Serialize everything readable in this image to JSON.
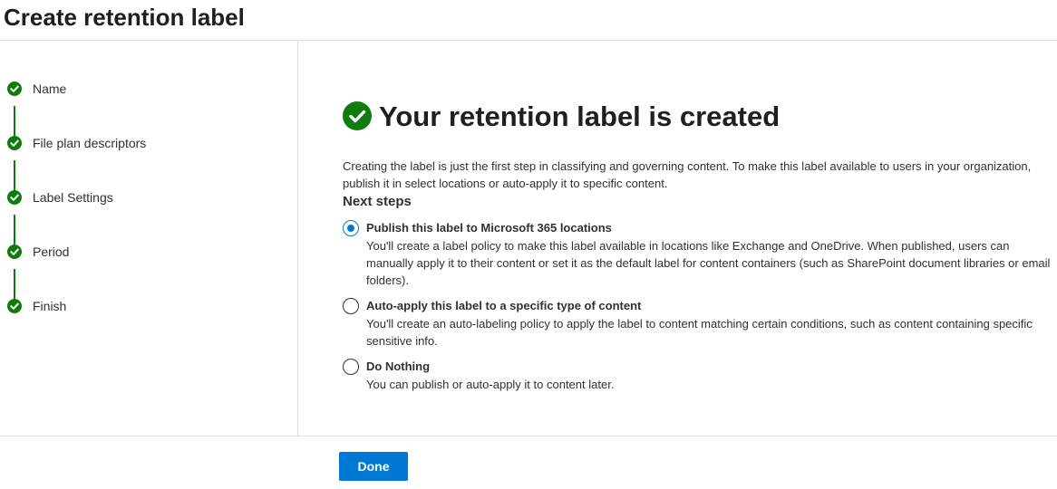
{
  "header": {
    "title": "Create retention label"
  },
  "sidebar": {
    "steps": [
      {
        "label": "Name",
        "status": "complete",
        "icon": "checkmark-icon"
      },
      {
        "label": "File plan descriptors",
        "status": "complete",
        "icon": "checkmark-icon"
      },
      {
        "label": "Label Settings",
        "status": "complete",
        "icon": "checkmark-icon"
      },
      {
        "label": "Period",
        "status": "complete",
        "icon": "checkmark-icon"
      },
      {
        "label": "Finish",
        "status": "complete",
        "icon": "checkmark-icon"
      }
    ]
  },
  "main": {
    "title": "Your retention label is created",
    "title_icon": "success-check-icon",
    "description": "Creating the label is just the first step in classifying and governing content. To make this label available to users in your organization, publish it in select locations or auto-apply it to specific content.",
    "next_steps_label": "Next steps",
    "options": [
      {
        "title": "Publish this label to Microsoft 365 locations",
        "description": "You'll create a label policy to make this label available in locations like Exchange and OneDrive. When published, users can manually apply it to their content or set it as the default label for content containers (such as SharePoint document libraries or email folders).",
        "selected": true
      },
      {
        "title": "Auto-apply this label to a specific type of content",
        "description": "You'll create an auto-labeling policy to apply the label to content matching certain conditions, such as content containing specific sensitive info.",
        "selected": false
      },
      {
        "title": "Do Nothing",
        "description": "You can publish or auto-apply it to content later.",
        "selected": false
      }
    ]
  },
  "footer": {
    "done_label": "Done"
  },
  "colors": {
    "success": "#107c10",
    "accent": "#0078d4",
    "text": "#323130",
    "divider": "#e1dfdd"
  }
}
